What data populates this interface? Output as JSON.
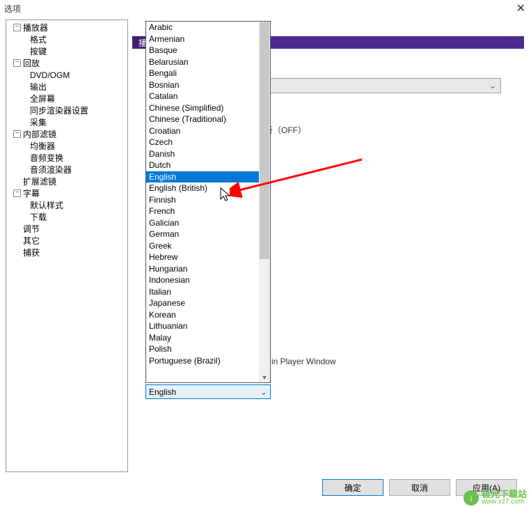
{
  "window": {
    "title": "选项",
    "close": "✕"
  },
  "sidebar": {
    "items": [
      {
        "label": "播放器",
        "children": [
          "格式",
          "按键"
        ]
      },
      {
        "label": "回放",
        "children": [
          "DVD/OGM",
          "输出",
          "全屏幕",
          "同步渲染器设置",
          "采集"
        ]
      },
      {
        "label": "内部滤镜",
        "children": [
          "均衡器",
          "音频变换",
          "音须渲染器"
        ]
      },
      {
        "label_plain": "扩展滤镜"
      },
      {
        "label": "字幕",
        "children": [
          "默认样式",
          "下载"
        ]
      },
      {
        "label_plain": "调节"
      },
      {
        "label_plain": "其它"
      },
      {
        "label_plain": "捕获"
      }
    ]
  },
  "content": {
    "tab_visible": "播",
    "off_text": "行（OFF）",
    "window_text": "n in Player Window"
  },
  "languages": [
    "Arabic",
    "Armenian",
    "Basque",
    "Belarusian",
    "Bengali",
    "Bosnian",
    "Catalan",
    "Chinese (Simplified)",
    "Chinese (Traditional)",
    "Croatian",
    "Czech",
    "Danish",
    "Dutch",
    "English",
    "English (British)",
    "Finnish",
    "French",
    "Galician",
    "German",
    "Greek",
    "Hebrew",
    "Hungarian",
    "Indonesian",
    "Italian",
    "Japanese",
    "Korean",
    "Lithuanian",
    "Malay",
    "Polish",
    "Portuguese (Brazil)"
  ],
  "selected_language": "English",
  "buttons": {
    "ok": "确定",
    "cancel": "取消",
    "apply": "应用(A)"
  },
  "watermark": {
    "symbol": "↓",
    "name": "极光下载站",
    "url": "www.xz7.com"
  }
}
